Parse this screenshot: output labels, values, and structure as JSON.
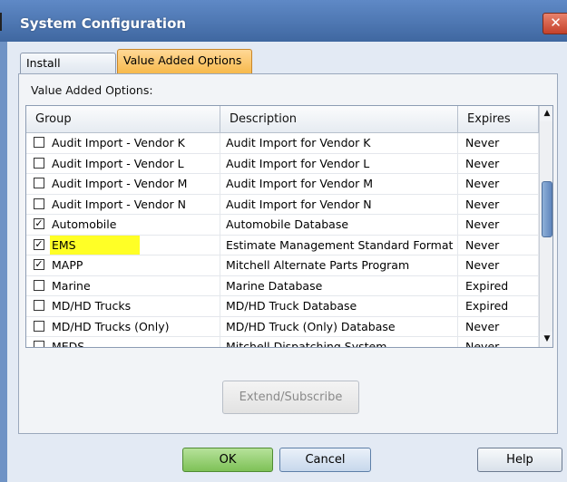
{
  "window": {
    "title": "System Configuration",
    "close_glyph": "✕"
  },
  "tabs": [
    {
      "label": "Install Settings",
      "active": false
    },
    {
      "label": "Value Added Options",
      "active": true
    }
  ],
  "panel_label": "Value Added Options:",
  "columns": {
    "group": "Group",
    "description": "Description",
    "expires": "Expires"
  },
  "rows": [
    {
      "group": "Audit Import - Vendor K",
      "description": "Audit Import for Vendor K",
      "expires": "Never",
      "checked": false
    },
    {
      "group": "Audit Import - Vendor L",
      "description": "Audit Import for Vendor L",
      "expires": "Never",
      "checked": false
    },
    {
      "group": "Audit Import - Vendor M",
      "description": "Audit Import for Vendor M",
      "expires": "Never",
      "checked": false
    },
    {
      "group": "Audit Import - Vendor N",
      "description": "Audit Import for Vendor N",
      "expires": "Never",
      "checked": false
    },
    {
      "group": "Automobile",
      "description": "Automobile Database",
      "expires": "Never",
      "checked": true
    },
    {
      "group": "EMS",
      "description": "Estimate Management Standard Format",
      "expires": "Never",
      "checked": true,
      "highlighted": true
    },
    {
      "group": "MAPP",
      "description": "Mitchell Alternate Parts Program",
      "expires": "Never",
      "checked": true
    },
    {
      "group": "Marine",
      "description": "Marine Database",
      "expires": "Expired",
      "checked": false
    },
    {
      "group": "MD/HD Trucks",
      "description": "MD/HD Truck Database",
      "expires": "Expired",
      "checked": false
    },
    {
      "group": "MD/HD Trucks (Only)",
      "description": "MD/HD Truck (Only) Database",
      "expires": "Never",
      "checked": false
    },
    {
      "group": "MEDS",
      "description": "Mitchell Dispatching System",
      "expires": "Never",
      "checked": false
    }
  ],
  "scrollbar": {
    "up_glyph": "▲",
    "down_glyph": "▼"
  },
  "buttons": {
    "extend": "Extend/Subscribe",
    "ok": "OK",
    "cancel": "Cancel",
    "help": "Help"
  },
  "colors": {
    "highlight": "#ffff26",
    "titlebar": "#4e77b2",
    "active_tab": "#f7b94c",
    "ok_button": "#7ec157"
  }
}
